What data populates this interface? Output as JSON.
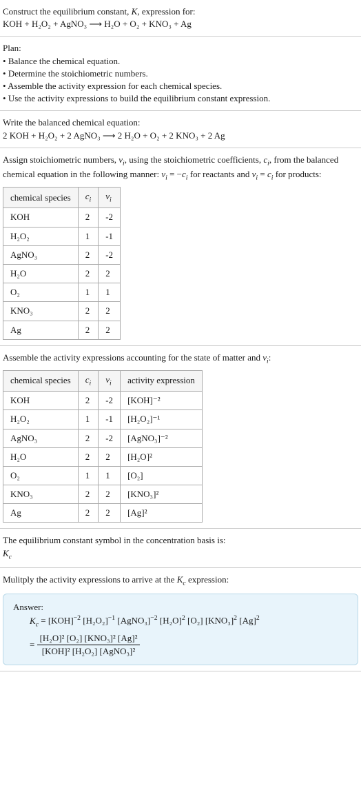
{
  "header": {
    "title": "Construct the equilibrium constant, K, expression for:",
    "equation": "KOH + H₂O₂ + AgNO₃  ⟶  H₂O + O₂ + KNO₃ + Ag"
  },
  "plan": {
    "title": "Plan:",
    "items": [
      "Balance the chemical equation.",
      "Determine the stoichiometric numbers.",
      "Assemble the activity expression for each chemical species.",
      "Use the activity expressions to build the equilibrium constant expression."
    ]
  },
  "balanced": {
    "title": "Write the balanced chemical equation:",
    "equation": "2 KOH + H₂O₂ + 2 AgNO₃  ⟶  2 H₂O + O₂ + 2 KNO₃ + 2 Ag"
  },
  "stoich": {
    "intro": "Assign stoichiometric numbers, νᵢ, using the stoichiometric coefficients, cᵢ, from the balanced chemical equation in the following manner: νᵢ = −cᵢ for reactants and νᵢ = cᵢ for products:",
    "headers": {
      "species": "chemical species",
      "ci": "cᵢ",
      "vi": "νᵢ"
    },
    "rows": [
      {
        "species": "KOH",
        "ci": "2",
        "vi": "-2"
      },
      {
        "species": "H₂O₂",
        "ci": "1",
        "vi": "-1"
      },
      {
        "species": "AgNO₃",
        "ci": "2",
        "vi": "-2"
      },
      {
        "species": "H₂O",
        "ci": "2",
        "vi": "2"
      },
      {
        "species": "O₂",
        "ci": "1",
        "vi": "1"
      },
      {
        "species": "KNO₃",
        "ci": "2",
        "vi": "2"
      },
      {
        "species": "Ag",
        "ci": "2",
        "vi": "2"
      }
    ]
  },
  "activity": {
    "intro": "Assemble the activity expressions accounting for the state of matter and νᵢ:",
    "headers": {
      "species": "chemical species",
      "ci": "cᵢ",
      "vi": "νᵢ",
      "expr": "activity expression"
    },
    "rows": [
      {
        "species": "KOH",
        "ci": "2",
        "vi": "-2",
        "expr": "[KOH]⁻²"
      },
      {
        "species": "H₂O₂",
        "ci": "1",
        "vi": "-1",
        "expr": "[H₂O₂]⁻¹"
      },
      {
        "species": "AgNO₃",
        "ci": "2",
        "vi": "-2",
        "expr": "[AgNO₃]⁻²"
      },
      {
        "species": "H₂O",
        "ci": "2",
        "vi": "2",
        "expr": "[H₂O]²"
      },
      {
        "species": "O₂",
        "ci": "1",
        "vi": "1",
        "expr": "[O₂]"
      },
      {
        "species": "KNO₃",
        "ci": "2",
        "vi": "2",
        "expr": "[KNO₃]²"
      },
      {
        "species": "Ag",
        "ci": "2",
        "vi": "2",
        "expr": "[Ag]²"
      }
    ]
  },
  "symbol": {
    "line1": "The equilibrium constant symbol in the concentration basis is:",
    "line2": "K𝒸"
  },
  "multiply": {
    "intro": "Mulitply the activity expressions to arrive at the K𝒸 expression:"
  },
  "answer": {
    "label": "Answer:",
    "line1": "K𝒸 = [KOH]⁻² [H₂O₂]⁻¹ [AgNO₃]⁻² [H₂O]² [O₂] [KNO₃]² [Ag]²",
    "frac_eq": "=",
    "num": "[H₂O]² [O₂] [KNO₃]² [Ag]²",
    "den": "[KOH]² [H₂O₂] [AgNO₃]²"
  }
}
